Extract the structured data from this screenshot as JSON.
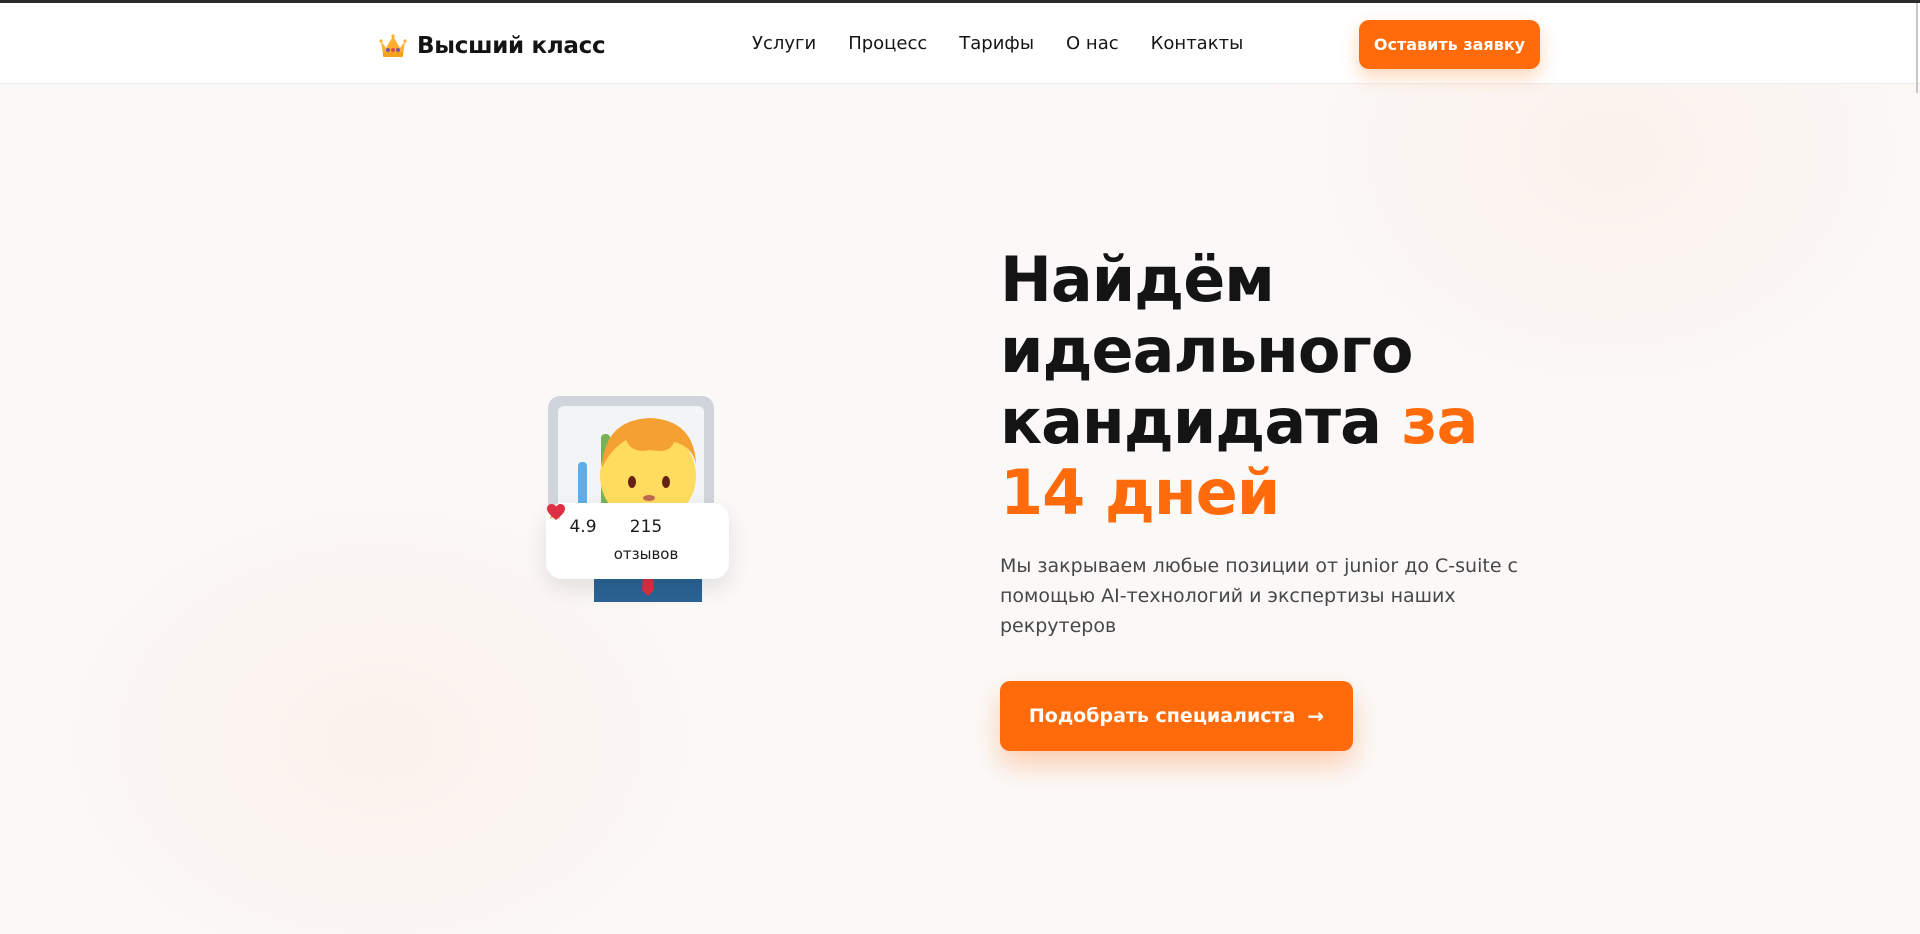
{
  "brand": {
    "name": "Высший класс",
    "logo_icon": "crown-icon"
  },
  "nav": {
    "items": [
      {
        "label": "Услуги"
      },
      {
        "label": "Процесс"
      },
      {
        "label": "Тарифы"
      },
      {
        "label": "О нас"
      },
      {
        "label": "Контакты"
      }
    ]
  },
  "header": {
    "cta_label": "Оставить заявку"
  },
  "hero": {
    "title_main": "Найдём идеального кандидата",
    "title_accent": "за 14 дней",
    "subtitle": "Мы закрываем любые позиции от junior до C-suite с помощью AI-технологий и экспертизы наших рекрутеров",
    "cta_label": "Подобрать специалиста",
    "cta_arrow": "→"
  },
  "rating_card": {
    "score": "4.9",
    "score_icon": "star-icon",
    "reviews_count": "215",
    "reviews_label": "отзывов",
    "heart_icon": "heart-icon"
  },
  "colors": {
    "accent": "#ff6b0a",
    "text": "#141414",
    "muted": "#474747"
  }
}
